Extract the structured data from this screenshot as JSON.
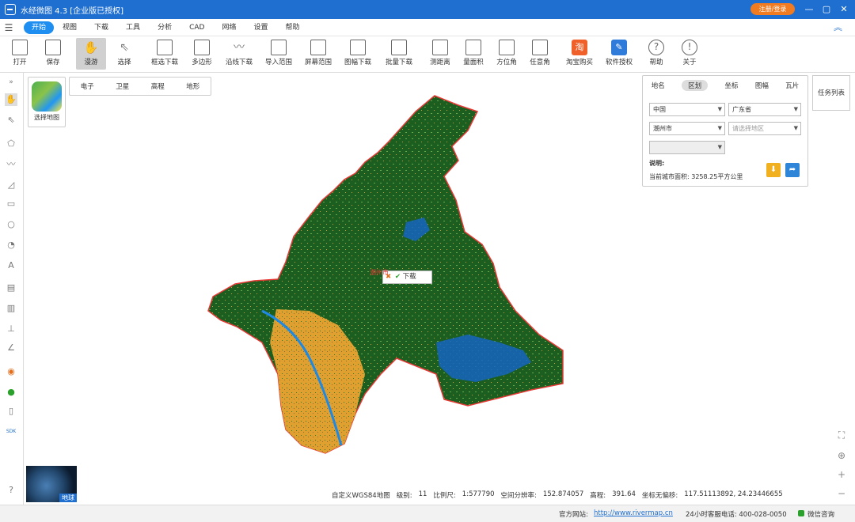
{
  "window": {
    "title": "水经微图 4.3 [企业版已授权]",
    "register_label": "注册/登录",
    "controls": [
      "—",
      "▢",
      "✕"
    ]
  },
  "menu": {
    "items": [
      "开始",
      "视图",
      "下载",
      "工具",
      "分析",
      "CAD",
      "网络",
      "设置",
      "帮助"
    ]
  },
  "toolbar": {
    "tools": [
      {
        "label": "打开",
        "icon": "folder-icon"
      },
      {
        "label": "保存",
        "icon": "save-icon"
      },
      {
        "label": "漫游",
        "icon": "hand-icon"
      },
      {
        "label": "选择",
        "icon": "pointer-icon"
      },
      {
        "label": "框选下载",
        "icon": "rect-download-icon"
      },
      {
        "label": "多边形",
        "icon": "polygon-icon"
      },
      {
        "label": "沿线下载",
        "icon": "line-download-icon"
      },
      {
        "label": "导入范围",
        "icon": "import-range-icon"
      },
      {
        "label": "屏幕范围",
        "icon": "screen-range-icon"
      },
      {
        "label": "图幅下载",
        "icon": "sheet-download-icon"
      },
      {
        "label": "批量下载",
        "icon": "batch-download-icon"
      },
      {
        "label": "测距离",
        "icon": "ruler-icon"
      },
      {
        "label": "量面积",
        "icon": "area-icon"
      },
      {
        "label": "方位角",
        "icon": "azimuth-icon"
      },
      {
        "label": "任意角",
        "icon": "angle-icon"
      },
      {
        "label": "淘宝购买",
        "icon": "taobao-icon"
      },
      {
        "label": "软件授权",
        "icon": "license-icon"
      },
      {
        "label": "帮助",
        "icon": "help-icon"
      },
      {
        "label": "关于",
        "icon": "info-icon"
      }
    ]
  },
  "map": {
    "basemap_selector_label": "选择地图",
    "basemap_tabs": [
      "电子",
      "卫星",
      "高程",
      "地形"
    ],
    "popup": {
      "label": "下载"
    },
    "region_label": "潮州市",
    "globe_label": "地球",
    "task_list_label": "任务列表"
  },
  "search_panel": {
    "tabs": [
      "地名",
      "区划",
      "坐标",
      "图幅",
      "瓦片"
    ],
    "country": "中国",
    "province": "广东省",
    "city": "潮州市",
    "district_placeholder": "请选择地区",
    "note_title": "说明:",
    "note_text": "当前城市面积: 3258.25平方公里"
  },
  "info": {
    "coord_system": "自定义WGS84地图",
    "level_label": "级别:",
    "level": "11",
    "scale_label": "比例尺:",
    "scale": "1:577790",
    "resolution_label": "空间分辨率:",
    "resolution": "152.874057",
    "elevation_label": "高程:",
    "elevation": "391.64",
    "coord_label": "坐标无偏移:",
    "coords": "117.51113892, 24.23446655"
  },
  "status": {
    "site_label": "官方网站:",
    "url": "http://www.rivermap.cn",
    "phone": "24小时客服电话: 400-028-0050",
    "wechat": "微信咨询"
  },
  "colors": {
    "title_bar": "#1f6fd0",
    "register": "#f07b20",
    "forest": "#1b5e20",
    "farmland": "#e0a030",
    "water": "#1565c0",
    "boundary": "#e53935"
  }
}
